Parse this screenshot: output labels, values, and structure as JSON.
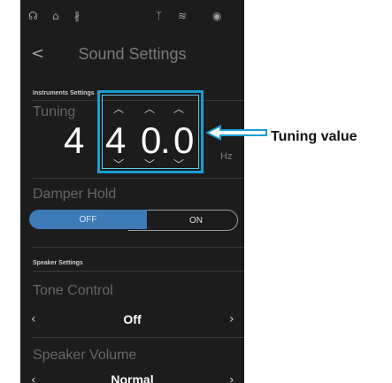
{
  "status_bar": {
    "icons": [
      "headphone-icon",
      "lock-icon",
      "bluetooth-icon",
      "usb-icon",
      "audio-icon",
      "wireless-icon"
    ]
  },
  "header": {
    "back_glyph": "<",
    "title": "Sound Settings"
  },
  "instruments": {
    "section_label": "Instruments Settings",
    "tuning_label": "Tuning",
    "tuning_digits": [
      "4",
      "4",
      "0",
      ".",
      "0"
    ],
    "unit": "Hz"
  },
  "damper": {
    "label": "Damper Hold",
    "off_label": "OFF",
    "on_label": "ON",
    "selected": "OFF"
  },
  "speaker": {
    "section_label": "Speaker Settings",
    "tone_label": "Tone Control",
    "tone_value": "Off",
    "volume_label": "Speaker Volume",
    "volume_value": "Normal"
  },
  "callout": {
    "label": "Tuning value"
  },
  "colors": {
    "accent": "#1a9ed4",
    "toggle_on": "#3d7ab8",
    "background": "#1c1c1c"
  }
}
